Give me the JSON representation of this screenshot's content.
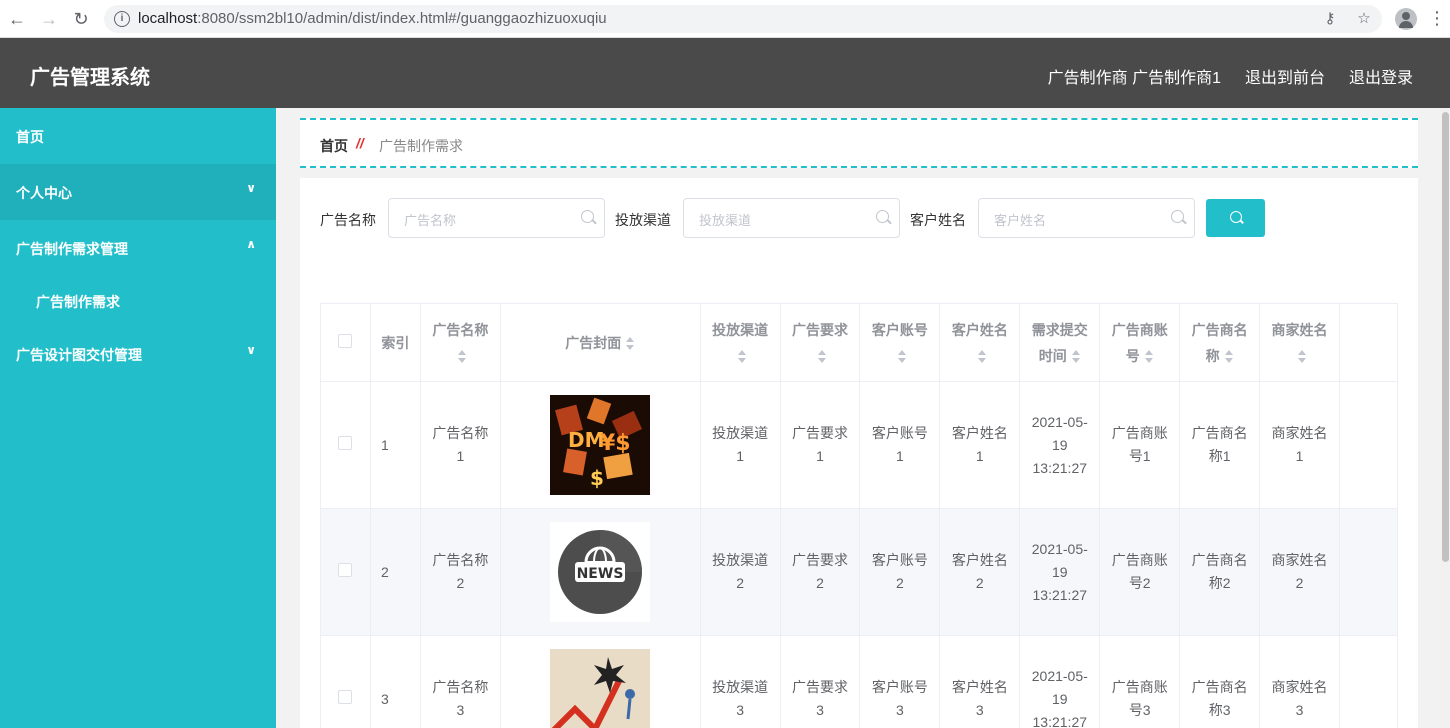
{
  "browser": {
    "url_host": "localhost",
    "url_path": ":8080/ssm2bl10/admin/dist/index.html#/guanggaozhizuoxuqiu"
  },
  "header": {
    "title": "广告管理系统",
    "user_role": "广告制作商",
    "user_name": "广告制作商1",
    "to_front": "退出到前台",
    "logout": "退出登录"
  },
  "sidebar": {
    "items": [
      {
        "label": "首页"
      },
      {
        "label": "个人中心"
      },
      {
        "label": "广告制作需求管理"
      },
      {
        "label": "广告制作需求"
      },
      {
        "label": "广告设计图交付管理"
      }
    ]
  },
  "breadcrumb": {
    "home": "首页",
    "separator": "//",
    "current": "广告制作需求"
  },
  "search": {
    "name_label": "广告名称",
    "name_placeholder": "广告名称",
    "channel_label": "投放渠道",
    "channel_placeholder": "投放渠道",
    "customer_label": "客户姓名",
    "customer_placeholder": "客户姓名"
  },
  "table": {
    "headers": [
      "索引",
      "广告名称",
      "广告封面",
      "投放渠道",
      "广告要求",
      "客户账号",
      "客户姓名",
      "需求提交时间",
      "广告商账号",
      "广告商名称",
      "商家姓名"
    ],
    "rows": [
      {
        "index": "1",
        "name": "广告名称1",
        "channel": "投放渠道1",
        "req": "广告要求1",
        "account": "客户账号1",
        "customer": "客户姓名1",
        "time": "2021-05-19 13:21:27",
        "adv_account": "广告商账号1",
        "adv_name": "广告商名称1",
        "merchant": "商家姓名1"
      },
      {
        "index": "2",
        "name": "广告名称2",
        "channel": "投放渠道2",
        "req": "广告要求2",
        "account": "客户账号2",
        "customer": "客户姓名2",
        "time": "2021-05-19 13:21:27",
        "adv_account": "广告商账号2",
        "adv_name": "广告商名称2",
        "merchant": "商家姓名2"
      },
      {
        "index": "3",
        "name": "广告名称3",
        "channel": "投放渠道3",
        "req": "广告要求3",
        "account": "客户账号3",
        "customer": "客户姓名3",
        "time": "2021-05-19 13:21:27",
        "adv_account": "广告商账号3",
        "adv_name": "广告商名称3",
        "merchant": "商家姓名3"
      }
    ]
  },
  "thumb_news_text": "NEWS",
  "colors": {
    "accent": "#22bfcb",
    "header_bg": "#4a4a4a"
  }
}
